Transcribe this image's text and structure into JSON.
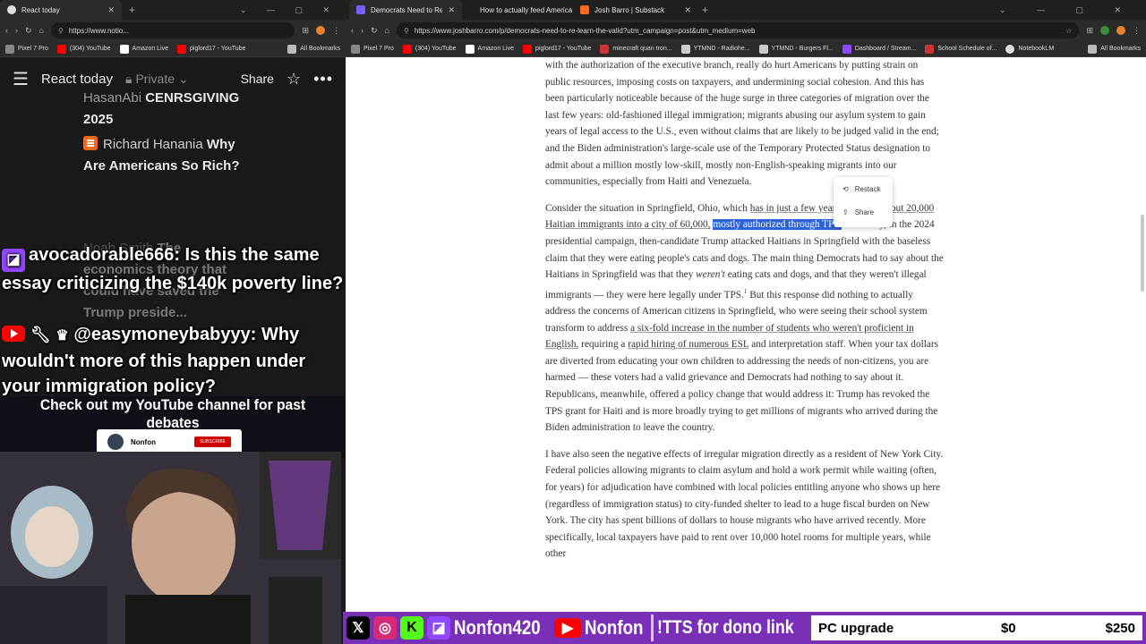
{
  "left_browser": {
    "tab": {
      "title": "React today",
      "close": "✕",
      "new_tab": "+"
    },
    "url": "https://www.notio...",
    "bookmarks": [
      "Pixel 7 Pro",
      "(304) YouTube",
      "Amazon Live",
      "piglord17 - YouTube",
      "All Bookmarks"
    ]
  },
  "notion": {
    "title": "React today",
    "privacy": "Private",
    "share": "Share",
    "items": [
      {
        "prefix": "HasanAbi",
        "title": "CENRSGIVING 2025"
      },
      {
        "prefix": "Richard Hanania",
        "title": "Why Are Americans So Rich?"
      },
      {
        "prefix": "Noah Smith",
        "title": "The economics theory that could have saved the Trump preside..."
      }
    ]
  },
  "chat": {
    "messages": [
      {
        "user": "avocadorable666:",
        "text": "Is this the same essay criticizing the $140k poverty line?",
        "platform": "twitch"
      },
      {
        "user": "@easymoneybabyyy:",
        "text": "Why wouldn't more of this happen under your immigration policy?",
        "platform": "youtube"
      }
    ]
  },
  "promo": {
    "check_text": "Check out my YouTube channel for past debates",
    "channel_name": "Nonfon",
    "subscribe": "SUBSCRIBE"
  },
  "right_browser": {
    "tabs": [
      {
        "title": "Democrats Need to Re-Learn ...",
        "active": true,
        "favicon_color": "#7b5cff"
      },
      {
        "title": "How to actually feed America",
        "active": false,
        "favicon_color": "#5a5a5a"
      },
      {
        "title": "Josh Barro | Substack",
        "active": false,
        "favicon_color": "#ff6719"
      }
    ],
    "url": "https://www.joshbarro.com/p/democrats-need-to-re-learn-the-valid?utm_campaign=post&utm_medium=web",
    "bookmarks": [
      "Pixel 7 Pro",
      "(304) YouTube",
      "Amazon Live",
      "piglord17 - YouTube",
      "minecraft quan tron...",
      "YTMND - Radiohe...",
      "YTMND - Burgers Fl...",
      "Dashboard / Stream...",
      "School Schedule of...",
      "NotebookLM",
      "All Bookmarks"
    ]
  },
  "article": {
    "p1": "with the authorization of the executive branch, really do hurt Americans by putting strain on public resources, imposing costs on taxpayers, and undermining social cohesion. And this has been particularly noticeable because of the huge surge in three categories of migration over the last few years: old-fashioned illegal immigration; migrants abusing our asylum system to gain years of legal access to the U.S., even without claims that are likely to be judged valid in the end; and the Biden administration's large-scale use of the Temporary Protected Status designation to admit about a million mostly low-skill, mostly non-English-speaking migrants into our communities, especially from Haiti and Venezuela.",
    "p2_a": "Consider the situation in Springfield, Ohio, which ",
    "p2_link": "has in just a few years absorbed about 20,000 Haitian immigrants into a city of 60,000,",
    "p2_hl": "mostly authorized through TPS.",
    "p2_b": " Famously, in the 2024 presidential campaign, then-candidate Trump attacked Haitians in Springfield with the baseless claim that they were eating people's cats and dogs. The main thing Democrats had to say about the Haitians in Springfield was that they ",
    "p2_em": "weren't",
    "p2_c": " eating cats and dogs, and that they weren't illegal immigrants — they were here legally under TPS.",
    "p2_sup": "1",
    "p2_d": " But this response did nothing to actually address the concerns of American citizens in Springfield, who were seeing their school system transform to address ",
    "p2_link2": "a six-fold increase in the number of students who weren't proficient in English",
    "p2_e": ", requiring a ",
    "p2_link3": "rapid hiring of numerous ESL",
    "p2_f": " and interpretation staff. When your tax dollars are diverted from educating your own children to addressing the needs of non-citizens, you are harmed — these voters had a valid grievance and Democrats had nothing to say about it. Republicans, meanwhile, offered a policy change that would address it: Trump has revoked the TPS grant for Haiti and is more broadly trying to get millions of migrants who arrived during the Biden administration to leave the country.",
    "p3": "I have also seen the negative effects of irregular migration directly as a resident of New York City. Federal policies allowing migrants to claim asylum and hold a work permit while waiting (often, for years) for adjudication have combined with local policies entitling anyone who shows up here (regardless of immigration status) to city-funded shelter to lead to a huge fiscal burden on New York. The city has spent billions of dollars to house migrants who have arrived recently. More specifically, local taxpayers have paid to rent over 10,000 hotel rooms for multiple years, while other"
  },
  "popup": {
    "restack": "Restack",
    "share": "Share"
  },
  "ticker": {
    "handle1": "Nonfon420",
    "handle2": "Nonfon",
    "tts": "!TTS for dono link",
    "goal_label": "PC upgrade",
    "goal_current": "$0",
    "goal_target": "$250"
  },
  "colors": {
    "accent_purple": "#7a2fb8",
    "highlight": "#2962d9",
    "twitch": "#9146ff",
    "youtube": "#ff0000"
  }
}
